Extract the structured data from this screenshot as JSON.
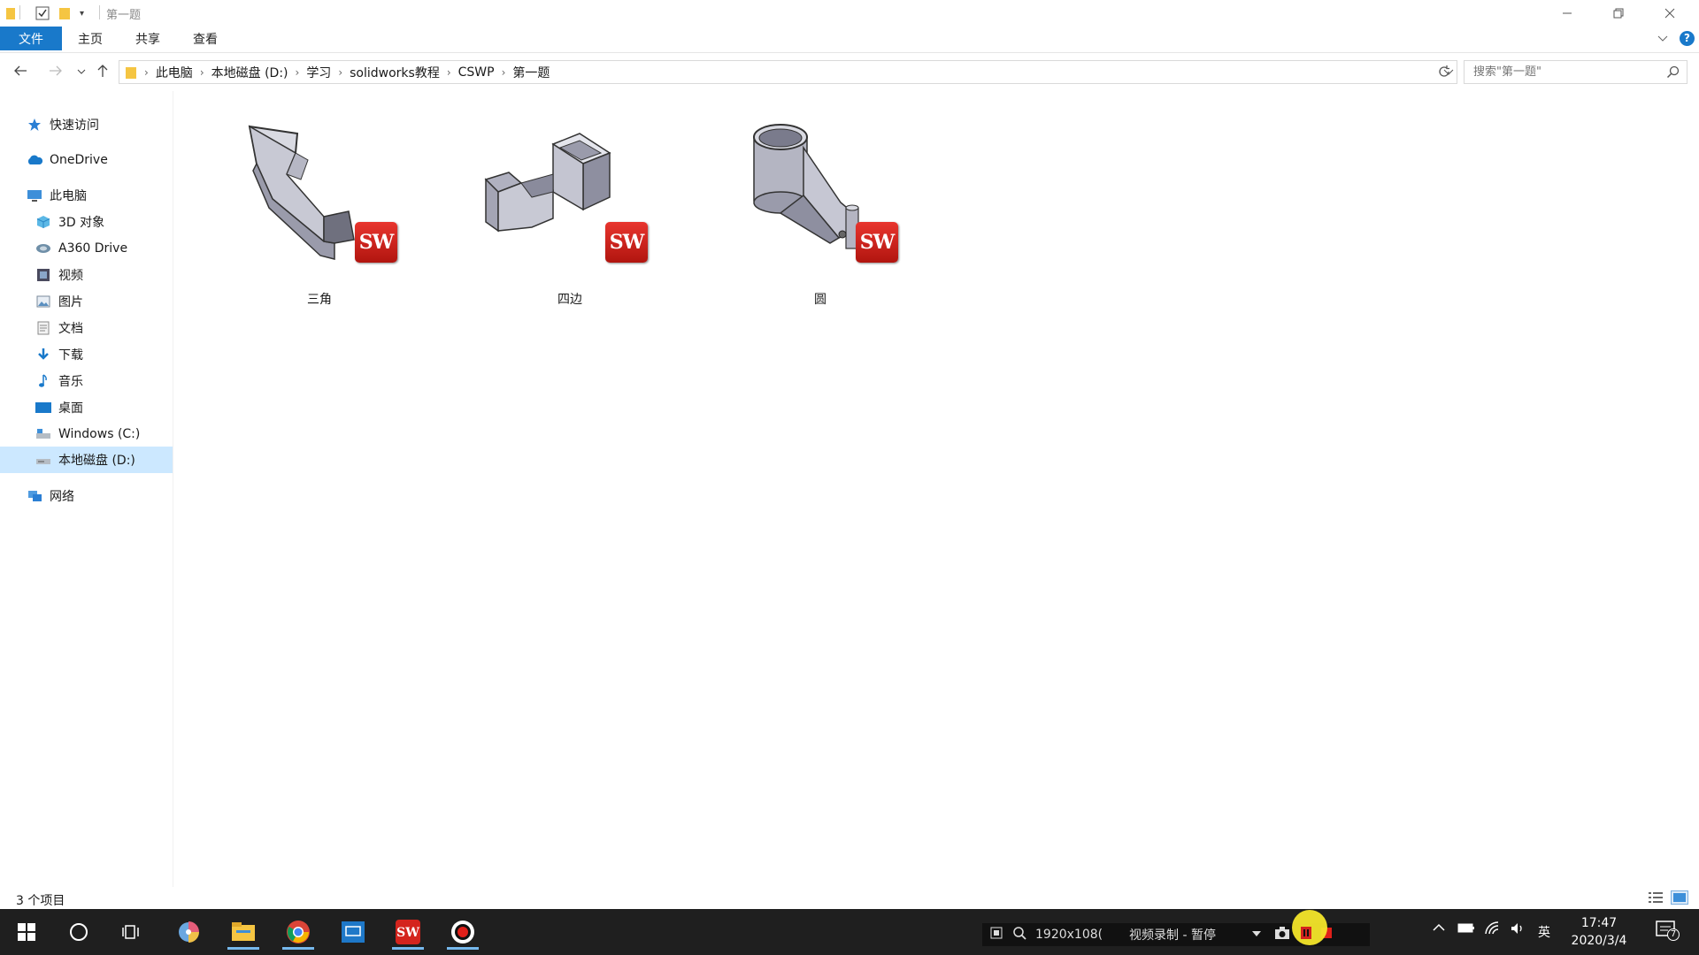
{
  "window": {
    "title": "第一题",
    "minimize_icon": "minimize-icon",
    "restore_icon": "restore-icon",
    "close_icon": "close-icon"
  },
  "ribbon": {
    "tabs": [
      {
        "label": "文件",
        "active": true
      },
      {
        "label": "主页"
      },
      {
        "label": "共享"
      },
      {
        "label": "查看"
      }
    ]
  },
  "address": {
    "crumbs": [
      "此电脑",
      "本地磁盘 (D:)",
      "学习",
      "solidworks教程",
      "CSWP",
      "第一题"
    ]
  },
  "search": {
    "placeholder": "搜索\"第一题\""
  },
  "sidebar": {
    "items": [
      {
        "label": "快速访问",
        "icon": "star-icon"
      },
      {
        "label": "OneDrive",
        "icon": "cloud-icon"
      },
      {
        "label": "此电脑",
        "icon": "computer-icon"
      },
      {
        "label": "3D 对象",
        "icon": "cube-icon"
      },
      {
        "label": "A360 Drive",
        "icon": "drive-icon"
      },
      {
        "label": "视频",
        "icon": "video-icon"
      },
      {
        "label": "图片",
        "icon": "picture-icon"
      },
      {
        "label": "文档",
        "icon": "document-icon"
      },
      {
        "label": "下载",
        "icon": "download-icon"
      },
      {
        "label": "音乐",
        "icon": "music-icon"
      },
      {
        "label": "桌面",
        "icon": "desktop-icon"
      },
      {
        "label": "Windows (C:)",
        "icon": "disk-icon"
      },
      {
        "label": "本地磁盘 (D:)",
        "icon": "disk-icon",
        "selected": true
      },
      {
        "label": "网络",
        "icon": "network-icon"
      }
    ]
  },
  "files": [
    {
      "name": "三角",
      "badge": "SW"
    },
    {
      "name": "四边",
      "badge": "SW"
    },
    {
      "name": "圆",
      "badge": "SW"
    }
  ],
  "status": {
    "count": "3 个项目"
  },
  "recorder": {
    "resolution": "1920x108(",
    "state": "视频录制 - 暂停"
  },
  "tray": {
    "ime": "英",
    "time": "17:47",
    "date": "2020/3/4",
    "notifications": "7"
  },
  "colors": {
    "accent": "#1979ca",
    "selection": "#cce8ff",
    "taskbar": "#1f1f1f",
    "sw_red": "#d4241d"
  }
}
